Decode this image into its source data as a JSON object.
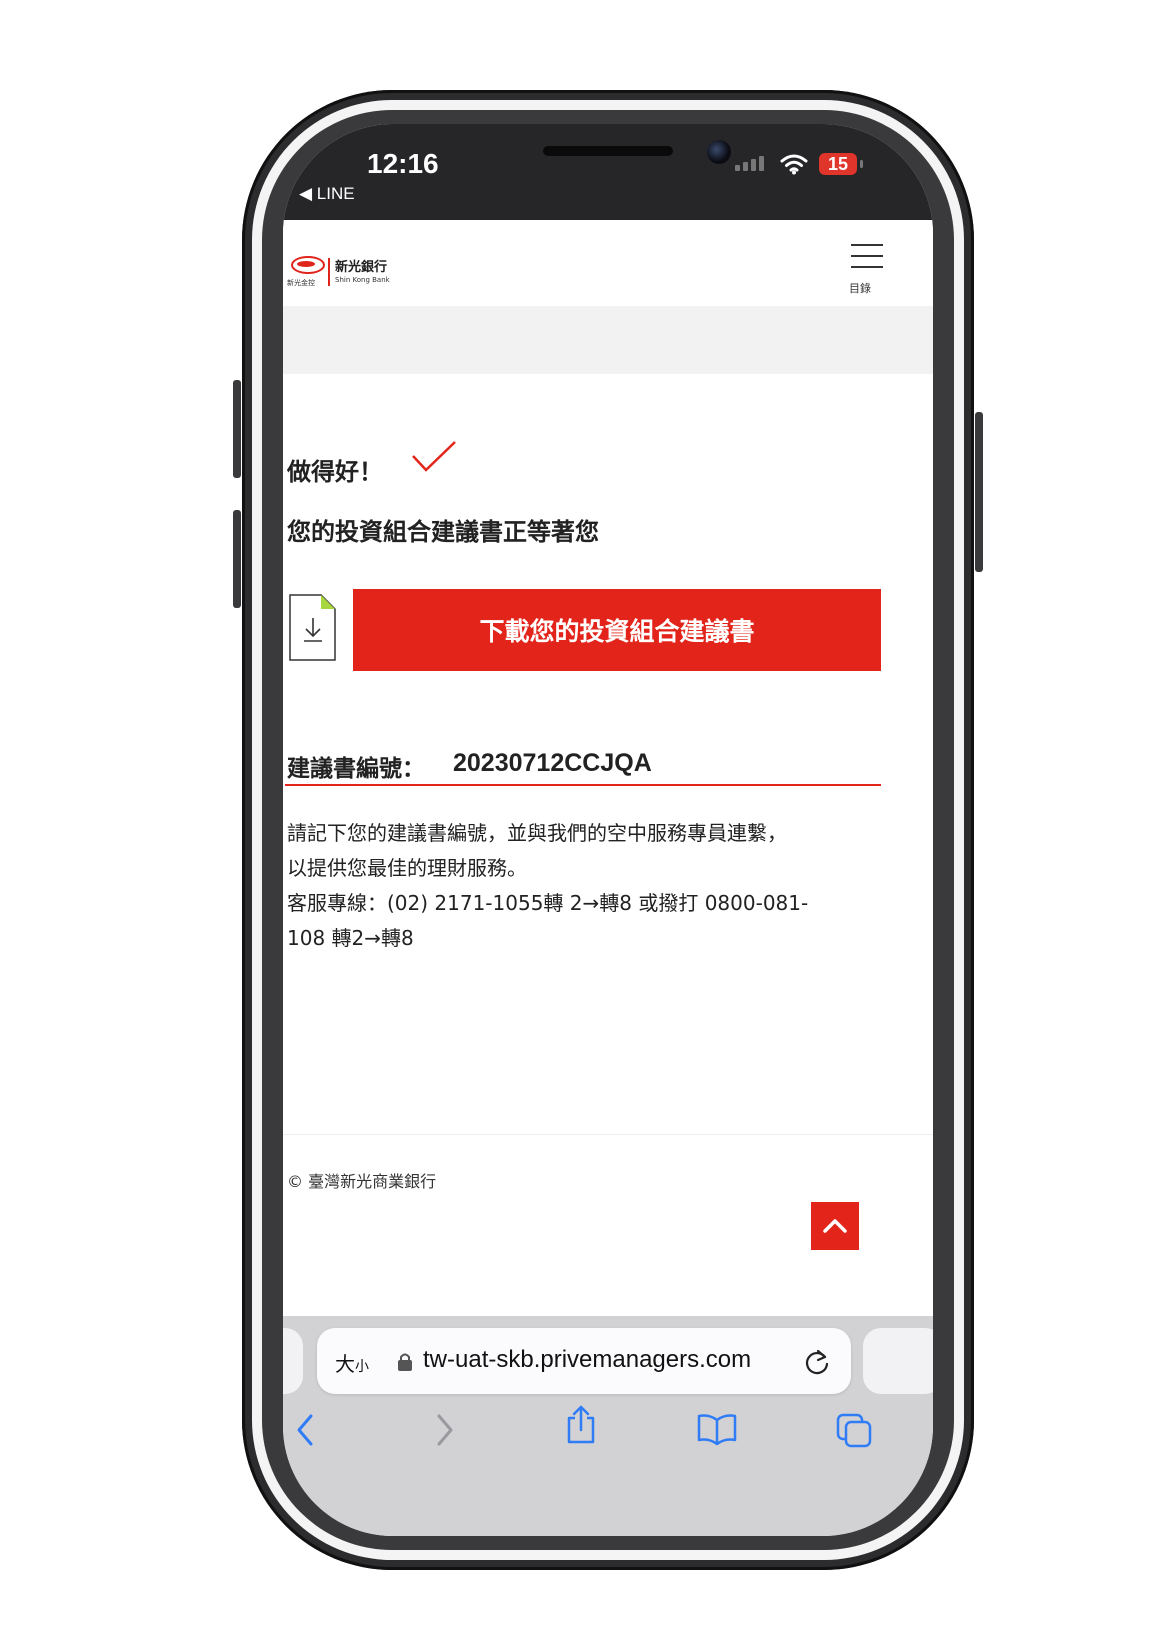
{
  "status_bar": {
    "time": "12:16",
    "back_app": "◀ LINE",
    "battery": "15"
  },
  "header": {
    "logo_name": "新光銀行",
    "logo_sub": "新光金控",
    "logo_en": "Shin Kong Bank",
    "menu_label": "目錄"
  },
  "content": {
    "heading": "做得好！",
    "subheading": "您的投資組合建議書正等著您",
    "download_button": "下載您的投資組合建議書",
    "ref_label": "建議書編號：",
    "ref_number": "20230712CCJQA",
    "body_lines": [
      "請記下您的建議書編號，並與我們的空中服務專員連繫，",
      "以提供您最佳的理財服務。",
      "客服專線：(02) 2171-1055轉 2→轉8 或撥打 0800-081-",
      "108 轉2→轉8"
    ]
  },
  "footer": {
    "copyright": "© 臺灣新光商業銀行"
  },
  "browser": {
    "text_size_large": "大",
    "text_size_small": "小",
    "url": "tw-uat-skb.privemanagers.com"
  },
  "colors": {
    "brand_red": "#e3241b",
    "status_bar": "#262628",
    "safari_bar": "#d2d2d4",
    "icon_blue": "#2f7cf6"
  }
}
